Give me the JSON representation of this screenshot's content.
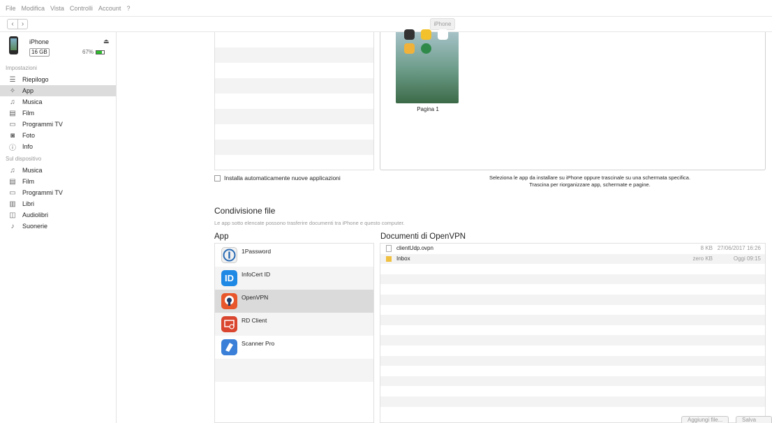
{
  "menu": [
    "File",
    "Modifica",
    "Vista",
    "Controlli",
    "Account",
    "?"
  ],
  "nav": {
    "back": "‹",
    "forward": "›",
    "device_tab": "iPhone"
  },
  "device": {
    "name": "iPhone",
    "capacity": "16 GB",
    "battery": "67%"
  },
  "sidebar": {
    "settings_label": "Impostazioni",
    "settings_items": [
      {
        "label": "Riepilogo",
        "icon": "☰"
      },
      {
        "label": "App",
        "icon": "✧"
      },
      {
        "label": "Musica",
        "icon": "♫"
      },
      {
        "label": "Film",
        "icon": "▤"
      },
      {
        "label": "Programmi TV",
        "icon": "▭"
      },
      {
        "label": "Foto",
        "icon": "◙"
      },
      {
        "label": "Info",
        "icon": "ⓘ"
      }
    ],
    "device_label": "Sul dispositivo",
    "device_items": [
      {
        "label": "Musica",
        "icon": "♫"
      },
      {
        "label": "Film",
        "icon": "▤"
      },
      {
        "label": "Programmi TV",
        "icon": "▭"
      },
      {
        "label": "Libri",
        "icon": "▥"
      },
      {
        "label": "Audiolibri",
        "icon": "◫"
      },
      {
        "label": "Suonerie",
        "icon": "♪"
      }
    ]
  },
  "apps_section": {
    "page_label": "Pagina 1",
    "auto_install_label": "Installa automaticamente nuove applicazioni",
    "hint_line1": "Seleziona le app da installare su iPhone oppure trascinale su una schermata specifica.",
    "hint_line2": "Trascina per riorganizzare app, schermate e pagine."
  },
  "file_sharing": {
    "title": "Condivisione file",
    "description": "Le app sotto elencate possono trasferire documenti tra iPhone e questo computer.",
    "apps_title": "App",
    "docs_title": "Documenti di OpenVPN",
    "apps": [
      {
        "name": "1Password",
        "color": "#2a6bb5"
      },
      {
        "name": "InfoCert ID",
        "color": "#1e88e5"
      },
      {
        "name": "OpenVPN",
        "color": "#e8572c"
      },
      {
        "name": "RD Client",
        "color": "#d9452e"
      },
      {
        "name": "Scanner Pro",
        "color": "#3a7fd8"
      }
    ],
    "documents": [
      {
        "name": "clientUdp.ovpn",
        "size": "8 KB",
        "date": "27/06/2017 16:26"
      },
      {
        "name": "Inbox",
        "size": "zero KB",
        "date": "Oggi 09:15"
      }
    ],
    "add_button": "Aggiungi file...",
    "save_button": "Salva in..."
  }
}
